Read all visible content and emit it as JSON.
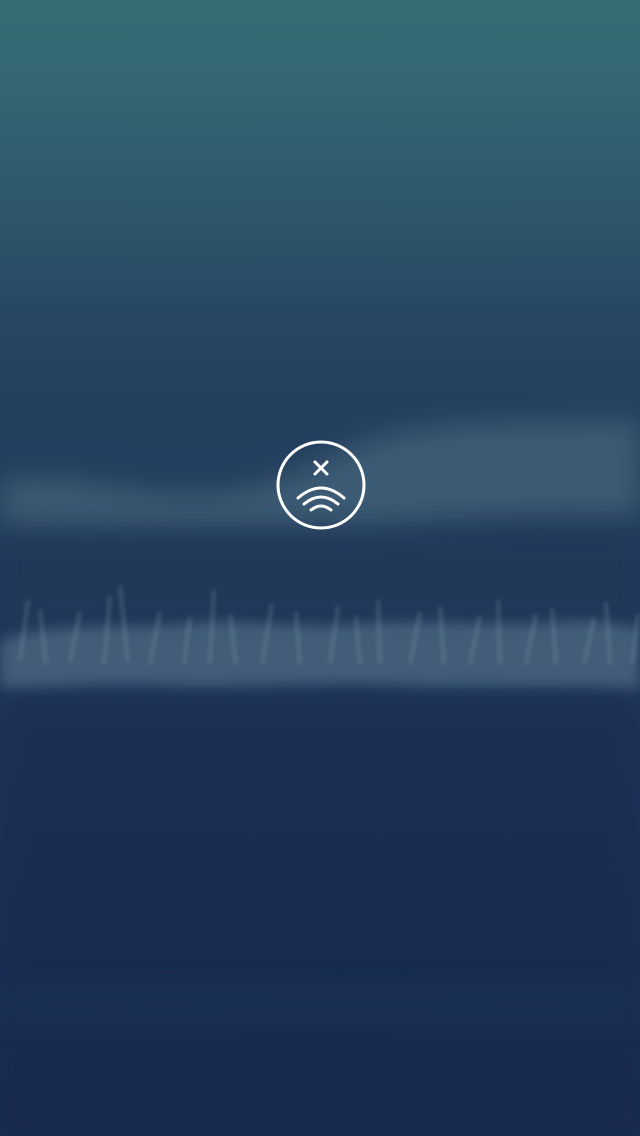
{
  "screen": {
    "background": "blurred-grass-field-photo",
    "overlay_color": "#1e3558",
    "accent_color": "#ffffff"
  },
  "status_indicator": {
    "icon": "no-connection-icon",
    "state": "offline"
  }
}
